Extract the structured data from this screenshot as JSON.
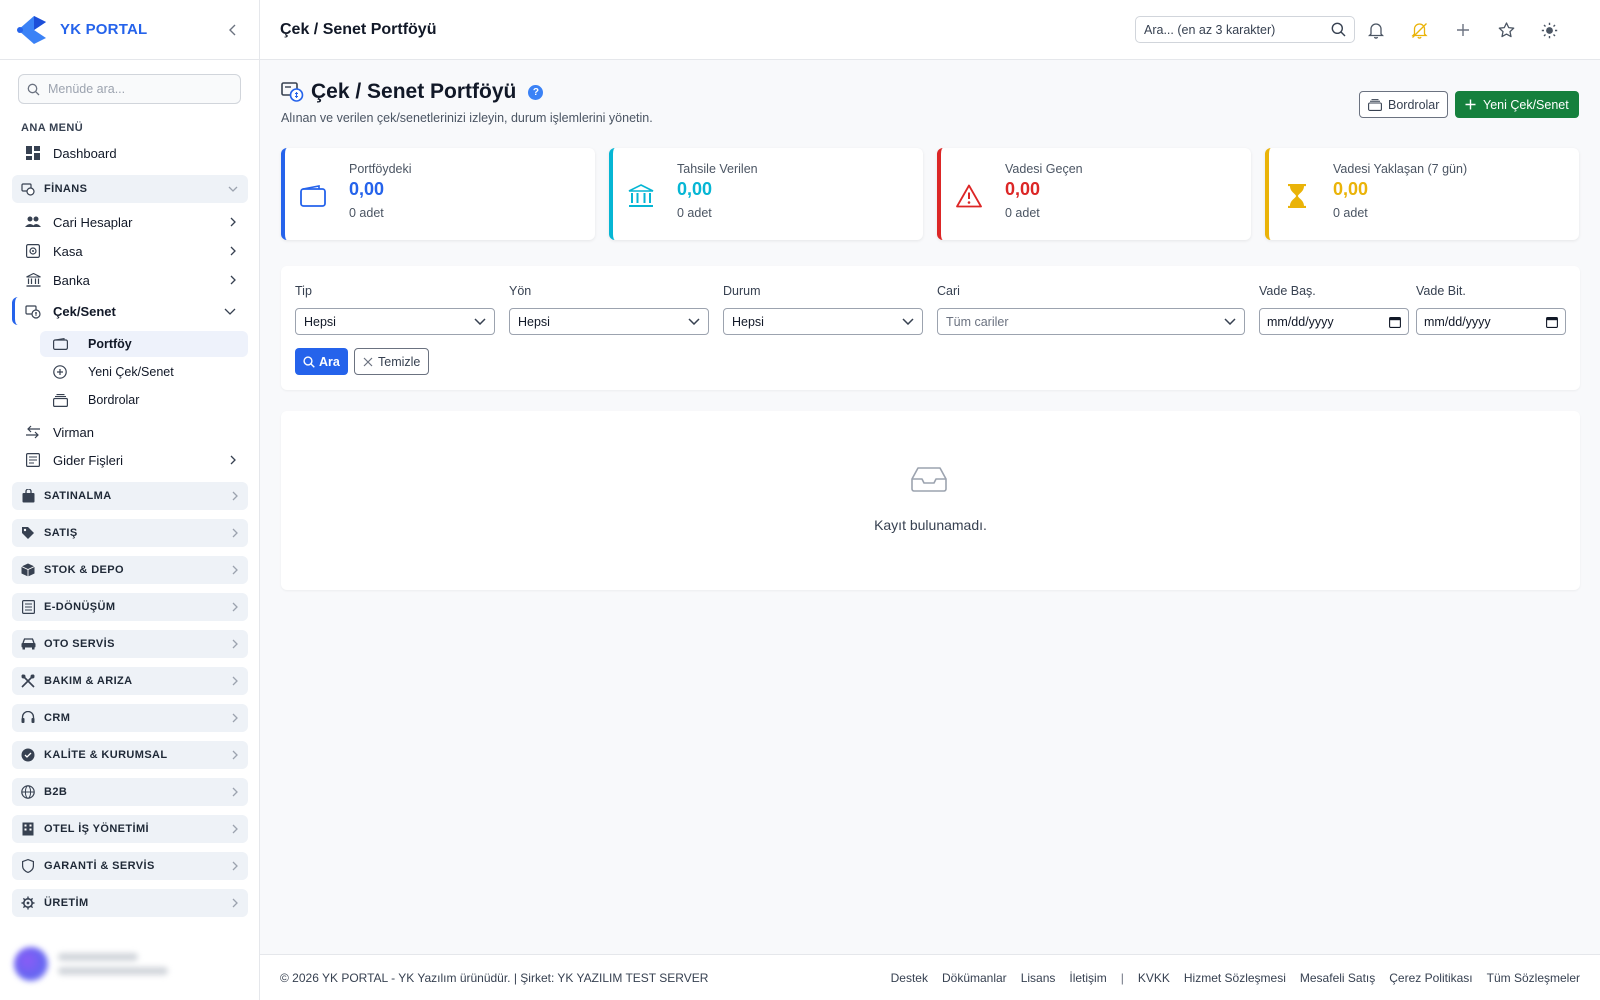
{
  "brand": {
    "name": "YK PORTAL"
  },
  "sidebar": {
    "search_placeholder": "Menüde ara...",
    "menu_title": "ANA MENÜ",
    "dashboard": "Dashboard",
    "finans_label": "FİNANS",
    "finans_items": [
      "Cari Hesaplar",
      "Kasa",
      "Banka",
      "Çek/Senet"
    ],
    "cek_sub": [
      "Portföy",
      "Yeni Çek/Senet",
      "Bordrolar"
    ],
    "virman": "Virman",
    "gider": "Gider Fişleri",
    "sections": [
      "SATINALMA",
      "SATIŞ",
      "STOK & DEPO",
      "E-DÖNÜŞÜM",
      "OTO SERVİS",
      "BAKIM & ARIZA",
      "CRM",
      "KALİTE & KURUMSAL",
      "B2B",
      "OTEL İŞ YÖNETİMİ",
      "GARANTİ & SERVİS",
      "ÜRETİM"
    ]
  },
  "topbar": {
    "title": "Çek / Senet Portföyü",
    "search_placeholder": "Ara... (en az 3 karakter)"
  },
  "page": {
    "title": "Çek / Senet Portföyü",
    "help": "?",
    "subtitle": "Alınan ve verilen çek/senetlerinizi izleyin, durum işlemlerini yönetin.",
    "btn_bordrolar": "Bordrolar",
    "btn_new": "Yeni Çek/Senet"
  },
  "cards": [
    {
      "label": "Portföydeki",
      "value": "0,00",
      "count": "0 adet",
      "color": "#2563eb"
    },
    {
      "label": "Tahsile Verilen",
      "value": "0,00",
      "count": "0 adet",
      "color": "#06b6d4"
    },
    {
      "label": "Vadesi Geçen",
      "value": "0,00",
      "count": "0 adet",
      "color": "#dc2626"
    },
    {
      "label": "Vadesi Yaklaşan (7 gün)",
      "value": "0,00",
      "count": "0 adet",
      "color": "#eab308"
    }
  ],
  "filters": {
    "tip_label": "Tip",
    "tip_value": "Hepsi",
    "yon_label": "Yön",
    "yon_value": "Hepsi",
    "durum_label": "Durum",
    "durum_value": "Hepsi",
    "cari_label": "Cari",
    "cari_placeholder": "Tüm cariler",
    "vbas_label": "Vade Baş.",
    "vbas_value": "mm/dd/yyyy",
    "vbit_label": "Vade Bit.",
    "vbit_value": "mm/dd/yyyy",
    "btn_search": "Ara",
    "btn_clear": "Temizle"
  },
  "empty": {
    "text": "Kayıt bulunamadı."
  },
  "footer": {
    "copyright": "© 2026 YK PORTAL - YK Yazılım ürünüdür. | Şirket: YK YAZILIM TEST SERVER",
    "links1": [
      "Destek",
      "Dökümanlar",
      "Lisans",
      "İletişim"
    ],
    "separator": "|",
    "links2": [
      "KVKK",
      "Hizmet Sözleşmesi",
      "Mesafeli Satış",
      "Çerez Politikası",
      "Tüm Sözleşmeler"
    ]
  }
}
